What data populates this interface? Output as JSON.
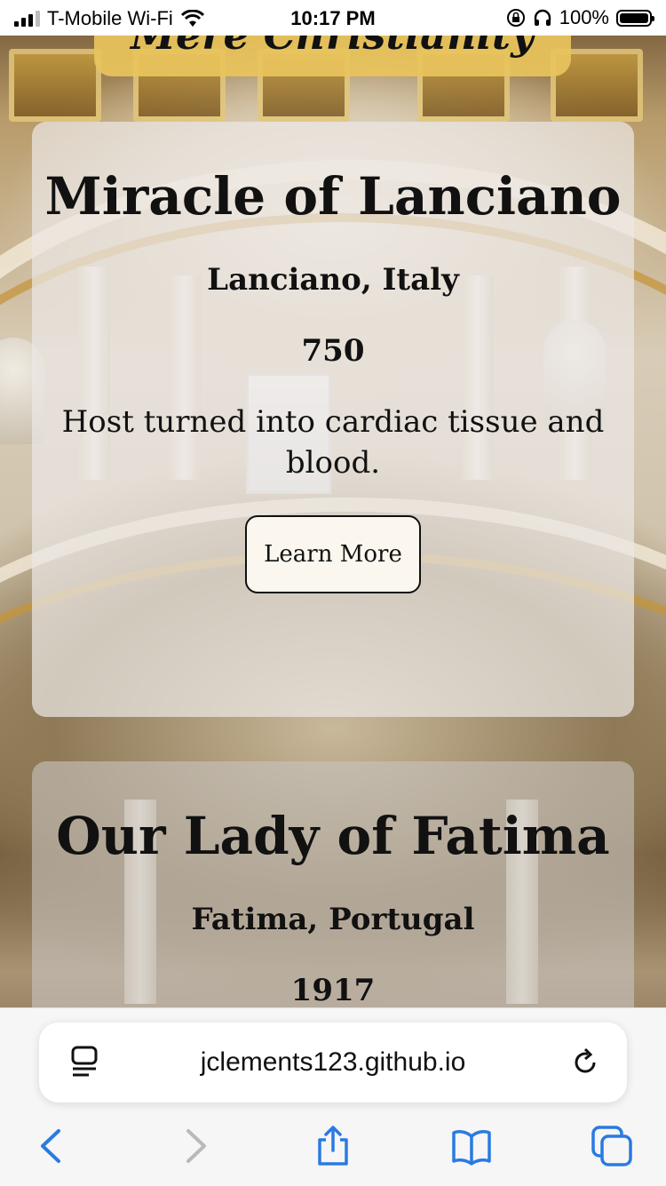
{
  "status_bar": {
    "carrier": "T-Mobile Wi-Fi",
    "time": "10:17 PM",
    "battery": "100%"
  },
  "header": {
    "brand": "Mere Christianity"
  },
  "cards": [
    {
      "title": "Miracle of Lanciano",
      "location": "Lanciano, Italy",
      "year": "750",
      "description": "Host turned into cardiac tissue and blood.",
      "button_label": "Learn More"
    },
    {
      "title": "Our Lady of Fatima",
      "location": "Fatima, Portugal",
      "year": "1917"
    }
  ],
  "browser": {
    "url": "jclements123.github.io",
    "accent_color": "#2a7ae2"
  },
  "icons": [
    "wifi-icon",
    "signal-icon",
    "lock-rotation-icon",
    "headphones-icon",
    "battery-icon",
    "reader-icon",
    "reload-icon",
    "back-icon",
    "forward-icon",
    "share-icon",
    "bookmarks-icon",
    "tabs-icon"
  ]
}
